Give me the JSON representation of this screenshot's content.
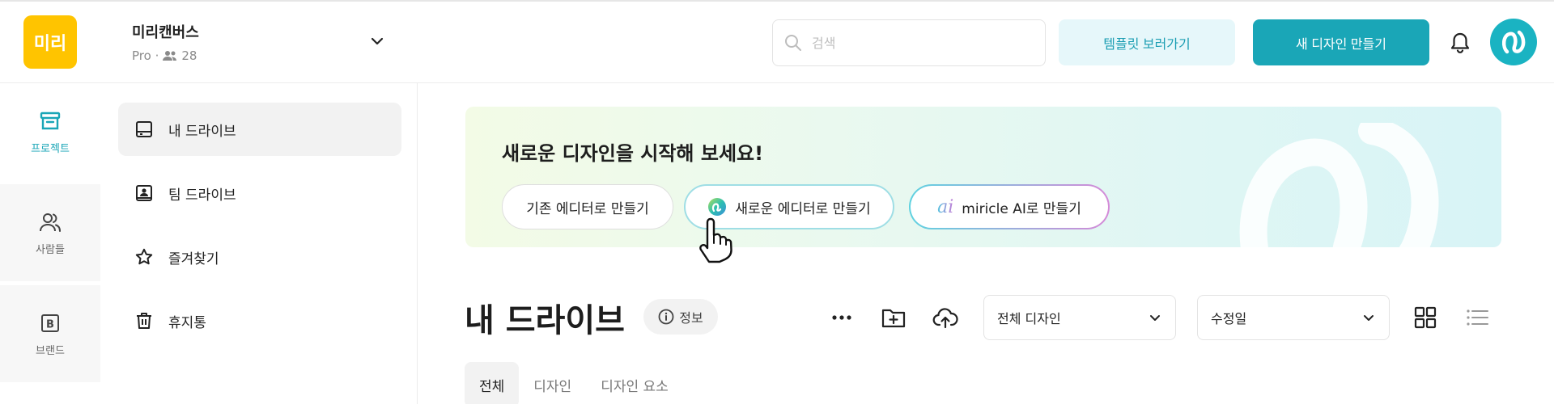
{
  "topbar": {
    "logo_text": "미리",
    "workspace_name": "미리캔버스",
    "workspace_plan": "Pro ·",
    "workspace_members": "28",
    "search_placeholder": "검색",
    "template_button": "템플릿 보러가기",
    "new_design_button": "새 디자인 만들기"
  },
  "rail": {
    "items": [
      {
        "label": "프로젝트"
      },
      {
        "label": "사람들"
      },
      {
        "label": "브랜드"
      }
    ]
  },
  "subnav": {
    "items": [
      {
        "label": "내 드라이브"
      },
      {
        "label": "팀 드라이브"
      },
      {
        "label": "즐겨찾기"
      },
      {
        "label": "휴지통"
      }
    ]
  },
  "banner": {
    "title": "새로운 디자인을 시작해 보세요!",
    "buttons": [
      {
        "label": "기존 에디터로 만들기"
      },
      {
        "label": "새로운 에디터로 만들기"
      },
      {
        "label": "miricle AI로 만들기",
        "icon_text": "ai"
      }
    ]
  },
  "main": {
    "title": "내 드라이브",
    "info_label": "정보",
    "filter_select": "전체 디자인",
    "sort_select": "수정일",
    "tabs": [
      {
        "label": "전체"
      },
      {
        "label": "디자인"
      },
      {
        "label": "디자인 요소"
      }
    ]
  },
  "colors": {
    "accent": "#1aa6b7",
    "logo_bg": "#ffc400",
    "template_button_bg": "#e6f7fa"
  }
}
